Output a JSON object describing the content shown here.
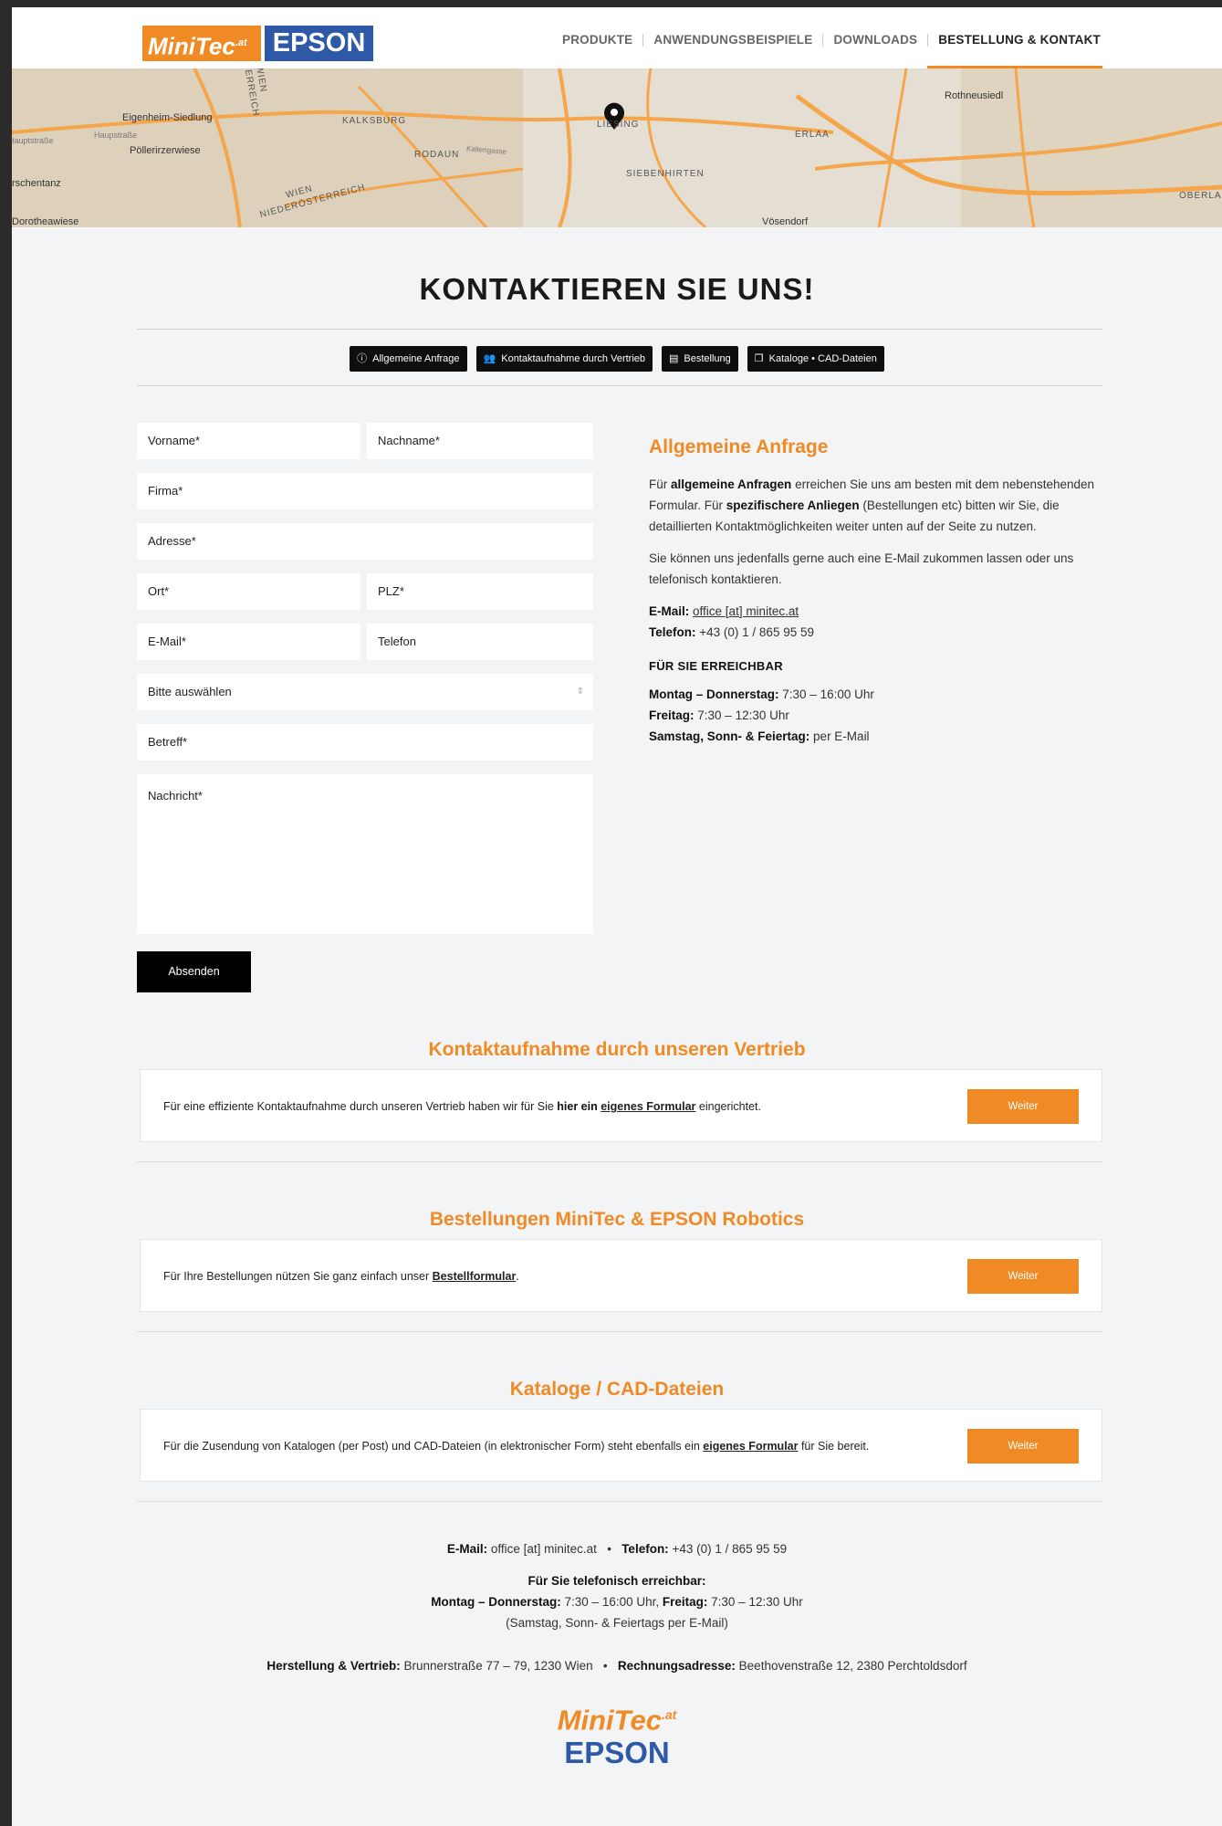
{
  "header": {
    "logo_minitec": "MiniTec",
    "logo_minitec_sup": ".at",
    "logo_epson": "EPSON",
    "nav": [
      "PRODUKTE",
      "ANWENDUNGSBEISPIELE",
      "DOWNLOADS",
      "BESTELLUNG & KONTAKT"
    ],
    "active_nav": "BESTELLUNG & KONTAKT"
  },
  "map": {
    "labels": [
      "ÖSTERREICH",
      "WIEN",
      "Eigenheim-Siedlung",
      "Hauptstraße",
      "Haupstraße",
      "Pöllerirzerwiese",
      "rschentanz",
      "Dorotheawiese",
      "KALKSBURG",
      "RODAUN",
      "Kaltengasse",
      "WIEN",
      "NIEDERÖSTERREICH",
      "LIESING",
      "SIEBENHIRTEN",
      "ERLAA",
      "Rothneusiedl",
      "OBERLA",
      "Vösendorf"
    ]
  },
  "main": {
    "title": "KONTAKTIEREN SIE UNS!",
    "tabs": [
      {
        "icon": "info-icon",
        "label": "Allgemeine Anfrage"
      },
      {
        "icon": "users-icon",
        "label": "Kontaktaufnahme durch Vertrieb"
      },
      {
        "icon": "clipboard-icon",
        "label": "Bestellung"
      },
      {
        "icon": "copy-icon",
        "label": "Kataloge • CAD-Dateien"
      }
    ]
  },
  "form": {
    "vorname": "Vorname*",
    "nachname": "Nachname*",
    "firma": "Firma*",
    "adresse": "Adresse*",
    "ort": "Ort*",
    "plz": "PLZ*",
    "email": "E-Mail*",
    "telefon": "Telefon",
    "select": "Bitte auswählen",
    "betreff": "Betreff*",
    "nachricht": "Nachricht*",
    "submit": "Absenden"
  },
  "info": {
    "heading": "Allgemeine Anfrage",
    "p1_a": "Für ",
    "p1_b": "allgemeine Anfragen",
    "p1_c": " erreichen Sie uns am besten mit dem nebenstehenden Formular. Für ",
    "p1_d": "spezifischere Anliegen",
    "p1_e": " (Bestellungen etc) bitten wir Sie, die detaillierten Kontaktmöglichkeiten weiter unten auf der Seite zu nutzen.",
    "p2": "Sie können uns jedenfalls gerne auch eine E-Mail zukommen lassen oder uns telefonisch kontaktieren.",
    "email_label": "E-Mail:",
    "email_value": "office [at] minitec.at",
    "phone_label": "Telefon:",
    "phone_value": "+43 (0) 1 / 865 95 59",
    "reach_heading": "FÜR SIE ERREICHBAR",
    "hours": [
      {
        "label": "Montag – Donnerstag:",
        "value": "7:30 – 16:00 Uhr"
      },
      {
        "label": "Freitag:",
        "value": "7:30 – 12:30 Uhr"
      },
      {
        "label": "Samstag, Sonn- & Feiertag:",
        "value": "per E-Mail"
      }
    ]
  },
  "sections": [
    {
      "title": "Kontaktaufnahme durch unseren Vertrieb",
      "text_a": "Für eine effiziente Kontaktaufnahme durch unseren Vertrieb haben wir für Sie ",
      "text_b": "hier ein ",
      "text_link": "eigenes Formular",
      "text_c": " eingerichtet.",
      "button": "Weiter"
    },
    {
      "title": "Bestellungen MiniTec & EPSON Robotics",
      "text_a": "Für Ihre Bestellungen nützen Sie ganz einfach unser ",
      "text_b": "",
      "text_link": "Bestellformular",
      "text_c": ".",
      "button": "Weiter"
    },
    {
      "title": "Kataloge / CAD-Dateien",
      "text_a": "Für die Zusendung von Katalogen (per Post) und CAD-Dateien (in elektronischer Form) steht ebenfalls ein ",
      "text_b": "",
      "text_link": "eigenes Formular",
      "text_c": " für Sie bereit.",
      "button": "Weiter"
    }
  ],
  "footer": {
    "email_label": "E-Mail:",
    "email_value": "office [at] minitec.at",
    "sep": "•",
    "phone_label": "Telefon:",
    "phone_value": "+43 (0) 1 / 865 95 59",
    "reach_heading": "Für Sie telefonisch erreichbar:",
    "hours_a_label": "Montag – Donnerstag:",
    "hours_a_value": "7:30 – 16:00 Uhr,",
    "hours_b_label": "Freitag:",
    "hours_b_value": "7:30 – 12:30 Uhr",
    "hours_c": "(Samstag, Sonn- & Feiertags per E-Mail)",
    "address_label": "Herstellung & Vertrieb:",
    "address_value": "Brunnerstraße 77 – 79, 1230 Wien",
    "billing_label": "Rechnungsadresse:",
    "billing_value": "Beethovenstraße 12, 2380 Perchtoldsdorf",
    "logo_minitec": "MiniTec",
    "logo_minitec_sup": ".at",
    "logo_epson": "EPSON"
  },
  "colors": {
    "accent": "#f08a24",
    "brand_blue": "#2d59a6",
    "tab_bg": "#0e0e0e"
  }
}
